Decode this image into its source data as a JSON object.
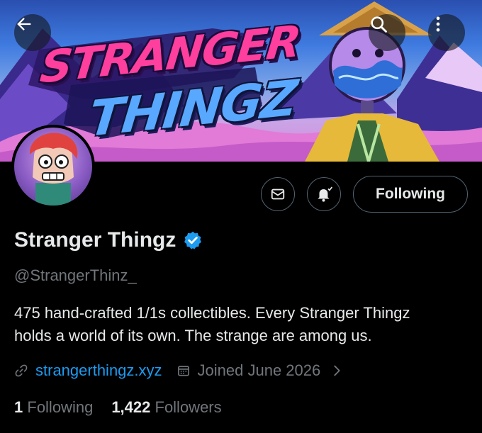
{
  "banner": {
    "logo_line1": "STRANGER",
    "logo_line2": "THINGZ"
  },
  "header": {
    "back_icon": "arrow-left-icon",
    "search_icon": "search-icon",
    "more_icon": "more-vertical-icon"
  },
  "actions": {
    "message_icon": "envelope-icon",
    "notify_icon": "bell-check-icon",
    "following_label": "Following"
  },
  "profile": {
    "display_name": "Stranger Thingz",
    "verified_icon": "verified-badge-icon",
    "handle": "@StrangerThinz_",
    "bio_line1": "475 hand-crafted 1/1s collectibles. Every Stranger Thingz",
    "bio_line2": "holds a world of its own. The strange are among us.",
    "link_icon": "link-icon",
    "website": "strangerthingz.xyz",
    "calendar_icon": "calendar-icon",
    "joined": "Joined June 2026",
    "chevron_icon": "chevron-right-icon"
  },
  "stats": {
    "following_count": "1",
    "following_label": "Following",
    "followers_count": "1,422",
    "followers_label": "Followers"
  },
  "colors": {
    "accent": "#1d9bf0",
    "muted": "#71767b",
    "text": "#e7e9ea",
    "border": "#536471",
    "background": "#000000"
  }
}
